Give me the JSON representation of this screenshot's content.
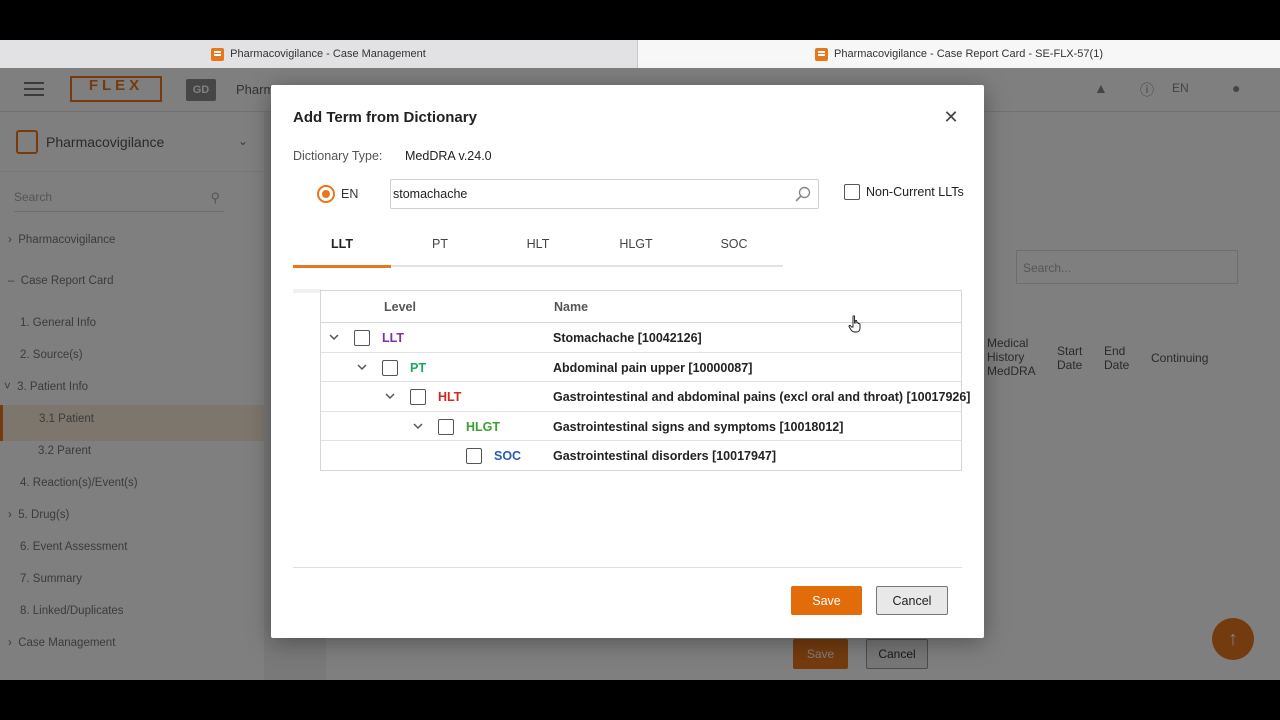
{
  "colors": {
    "accent": "#e8761c",
    "save": "#e36c0a",
    "llt": "#7b2fa8",
    "pt": "#1aa860",
    "hlt": "#d0281c",
    "hlgt": "#3aa234",
    "soc": "#2b5bb5"
  },
  "browser_tabs": [
    {
      "label": "Pharmacovigilance - Case Management",
      "icon": "app-favicon"
    },
    {
      "label": "Pharmacovigilance - Case Report Card - SE-FLX-57(1)",
      "icon": "app-favicon"
    }
  ],
  "topbar": {
    "logo": "FLEX",
    "badge": "GD",
    "truncated_title": "Pharm",
    "language": "EN"
  },
  "sidebar": {
    "module": "Pharmacovigilance",
    "search_placeholder": "Search",
    "items": [
      {
        "label": "Pharmacovigilance",
        "prefix": "›"
      },
      {
        "label": "Case Report Card",
        "prefix": "–"
      },
      {
        "label": "1. General Info",
        "prefix": ""
      },
      {
        "label": "2. Source(s)",
        "prefix": ""
      },
      {
        "label": "3. Patient Info",
        "prefix": "˅"
      },
      {
        "label": "3.1 Patient",
        "prefix": ""
      },
      {
        "label": "3.2 Parent",
        "prefix": ""
      },
      {
        "label": "4. Reaction(s)/Event(s)",
        "prefix": ""
      },
      {
        "label": "5. Drug(s)",
        "prefix": "›"
      },
      {
        "label": "6. Event Assessment",
        "prefix": ""
      },
      {
        "label": "7. Summary",
        "prefix": ""
      },
      {
        "label": "8. Linked/Duplicates",
        "prefix": ""
      },
      {
        "label": "Case Management",
        "prefix": "›"
      }
    ]
  },
  "background": {
    "save_label": "Save",
    "cancel_label": "Cancel",
    "search_placeholder": "Search...",
    "columns": [
      "Medical History MedDRA",
      "Start Date",
      "End Date",
      "Continuing"
    ]
  },
  "modal": {
    "title": "Add Term from Dictionary",
    "dictionary_type_label": "Dictionary Type:",
    "dictionary_type_value": "MedDRA v.24.0",
    "language_option": "EN",
    "search_value": "stomachache",
    "non_current_label": "Non-Current LLTs",
    "tabs": [
      "LLT",
      "PT",
      "HLT",
      "HLGT",
      "SOC"
    ],
    "active_tab": "LLT",
    "table_headers": {
      "level": "Level",
      "name": "Name"
    },
    "rows": [
      {
        "level": "LLT",
        "name": "Stomachache [10042126]",
        "depth": 0,
        "expanded": true,
        "color": "#7b2fa8"
      },
      {
        "level": "PT",
        "name": "Abdominal pain upper [10000087]",
        "depth": 1,
        "expanded": true,
        "color": "#1aa860"
      },
      {
        "level": "HLT",
        "name": "Gastrointestinal and abdominal pains (excl oral and throat) [10017926]",
        "depth": 2,
        "expanded": true,
        "color": "#d0281c"
      },
      {
        "level": "HLGT",
        "name": "Gastrointestinal signs and symptoms [10018012]",
        "depth": 3,
        "expanded": true,
        "color": "#3aa234"
      },
      {
        "level": "SOC",
        "name": "Gastrointestinal disorders [10017947]",
        "depth": 4,
        "expanded": false,
        "color": "#2b5bb5"
      }
    ],
    "save_label": "Save",
    "cancel_label": "Cancel"
  }
}
